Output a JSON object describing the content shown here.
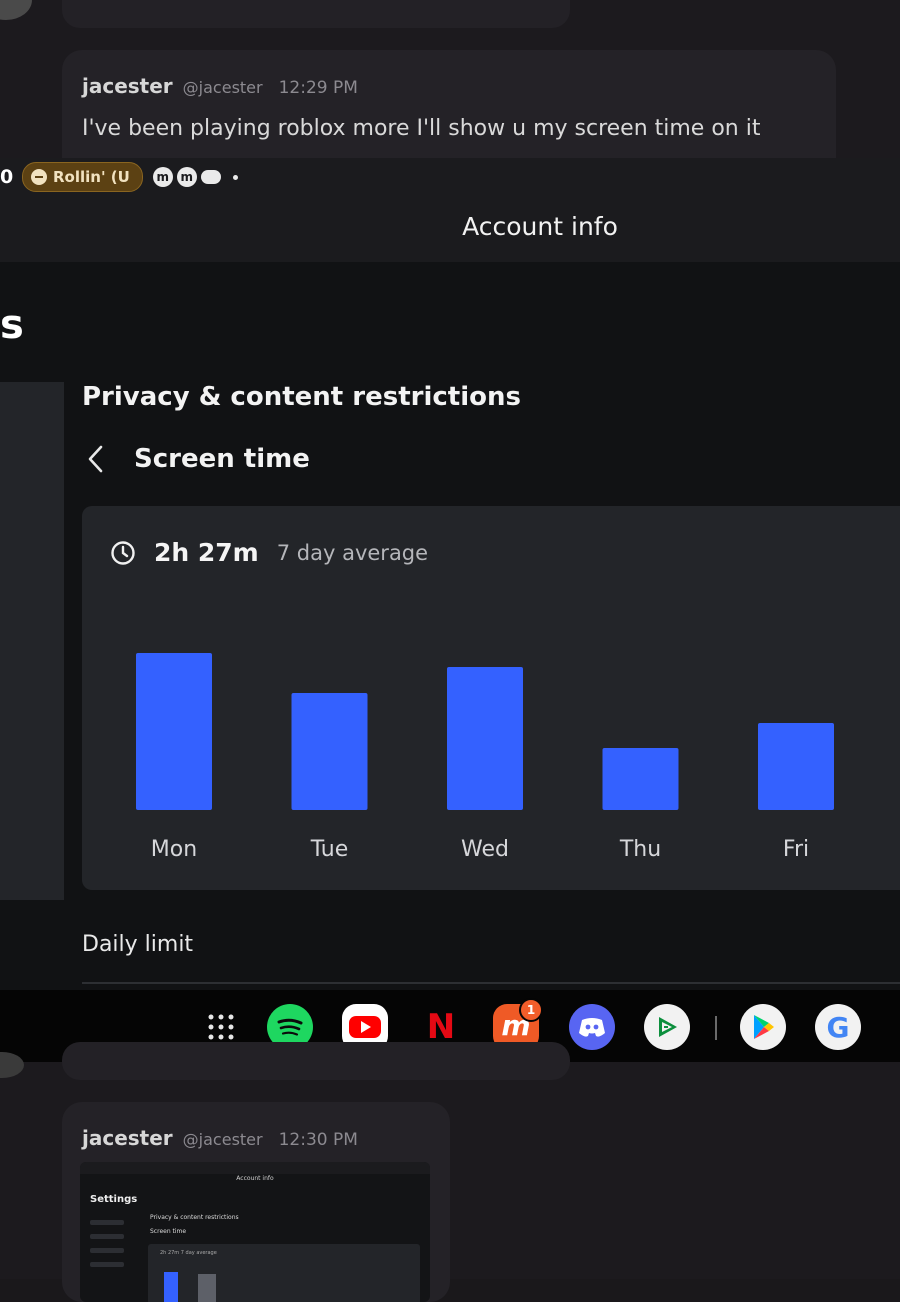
{
  "chat": {
    "message1": {
      "username": "jacester",
      "handle": "@jacester",
      "time": "12:29 PM",
      "text": "I've been playing roblox more I'll show u my screen time on it"
    },
    "message2": {
      "username": "jacester",
      "handle": "@jacester",
      "time": "12:30 PM"
    }
  },
  "status_bar": {
    "number": "0",
    "media_pill": "Rollin' (U",
    "icons": [
      "m-icon",
      "m-icon",
      "cloud-icon",
      "dot-icon"
    ]
  },
  "app": {
    "header_title": "Account info",
    "settings_partial": "s",
    "section_title": "Privacy & content restrictions",
    "back_label": "Screen time",
    "average": {
      "value": "2h 27m",
      "label": "7 day average"
    },
    "daily_limit_label": "Daily limit"
  },
  "chart_data": {
    "type": "bar",
    "categories": [
      "Mon",
      "Tue",
      "Wed",
      "Thu",
      "Fri"
    ],
    "values": [
      157,
      117,
      143,
      62,
      87
    ],
    "title": "",
    "xlabel": "",
    "ylabel": "",
    "ylim": [
      0,
      200
    ],
    "grid": false,
    "bar_color": "#3461ff"
  },
  "taskbar": {
    "apps": [
      {
        "name": "apps-grid-icon"
      },
      {
        "name": "spotify-icon"
      },
      {
        "name": "youtube-icon"
      },
      {
        "name": "netflix-icon",
        "glyph": "N"
      },
      {
        "name": "mangatoon-icon",
        "glyph": "m",
        "badge": "1"
      },
      {
        "name": "discord-icon"
      },
      {
        "name": "play-games-icon"
      },
      {
        "name": "play-store-icon"
      },
      {
        "name": "google-icon",
        "glyph": "G"
      }
    ]
  },
  "thumbnail": {
    "title": "Account info",
    "settings": "Settings",
    "section": "Privacy & content restrictions",
    "screen": "Screen time",
    "average": "2h 27m  7 day average"
  },
  "colors": {
    "accent_bar": "#3461ff",
    "card_bg": "#232529",
    "app_bg": "#111214",
    "spotify": "#1ed760",
    "youtube": "#ff0000",
    "netflix": "#e50914",
    "discord": "#5865f2",
    "badge": "#f25d2a"
  }
}
